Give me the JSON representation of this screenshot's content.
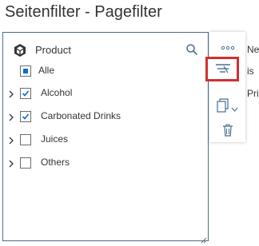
{
  "page": {
    "title": "Seitenfilter - Pagefilter"
  },
  "filter_panel": {
    "header_label": "Product",
    "items": [
      {
        "label": "Alle",
        "state": "partial",
        "expandable": false
      },
      {
        "label": "Alcohol",
        "state": "checked",
        "expandable": true
      },
      {
        "label": "Carbonated Drinks",
        "state": "checked",
        "expandable": true
      },
      {
        "label": "Juices",
        "state": "unchecked",
        "expandable": true
      },
      {
        "label": "Others",
        "state": "unchecked",
        "expandable": true
      }
    ]
  },
  "side_toolbar": {
    "more_label": "°°°"
  },
  "background_clipped": {
    "line1": "Ne",
    "line2": "is",
    "line3": "Pric"
  },
  "colors": {
    "accent": "#0a6ed1",
    "panel_border": "#4a6f8f",
    "highlight_border": "#d0312d",
    "text": "#32363a"
  }
}
